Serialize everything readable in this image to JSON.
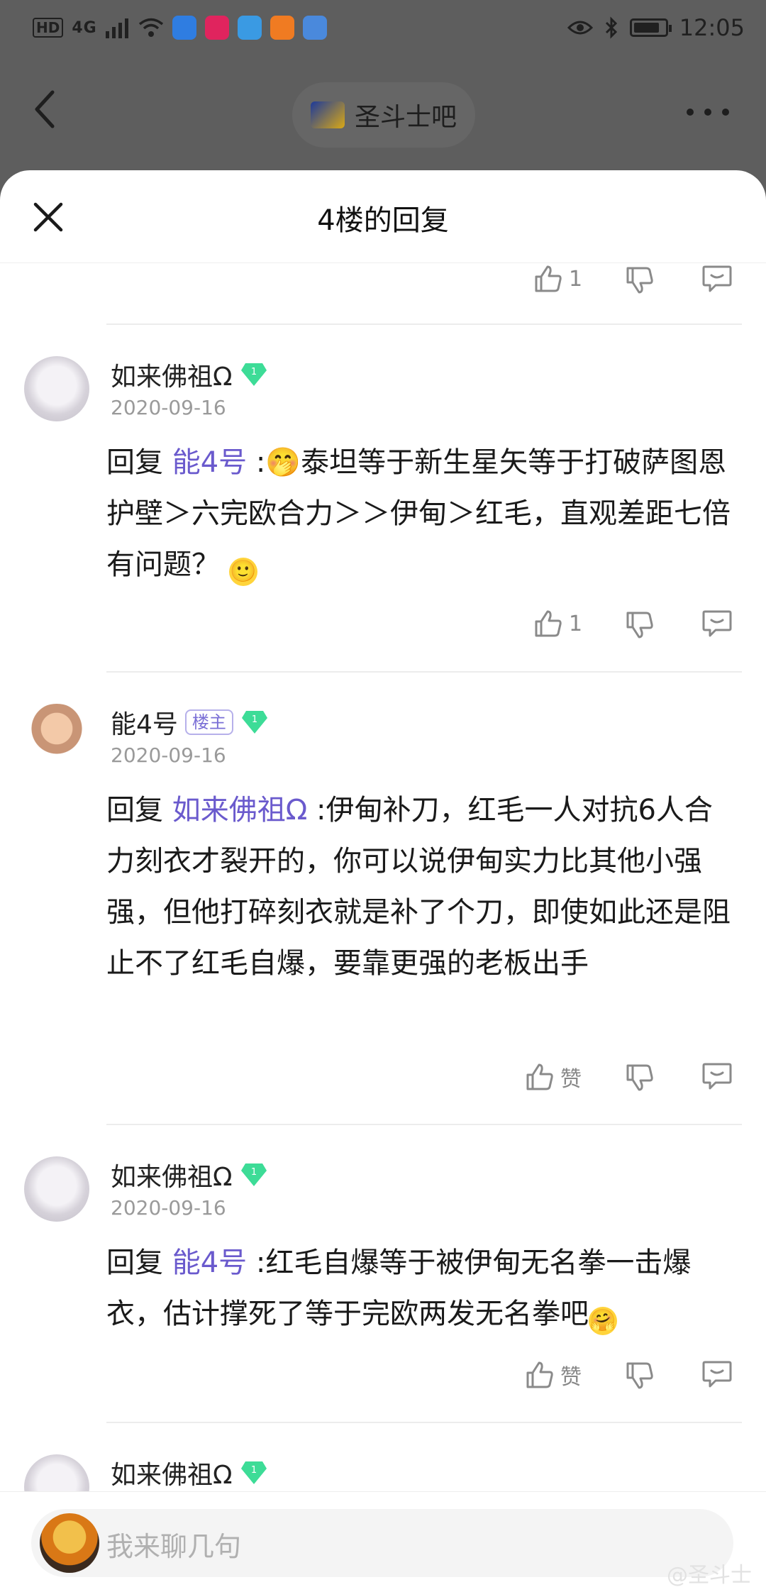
{
  "status_bar": {
    "hd": "HD",
    "network": "4G",
    "time": "12:05",
    "battery_level": 0.85
  },
  "nav": {
    "forum_name": "圣斗士吧"
  },
  "sheet": {
    "title": "4楼的回复"
  },
  "top_actions": {
    "like_count": "1"
  },
  "comments": [
    {
      "user": "如来佛祖Ω",
      "level": "1",
      "date": "2020-09-16",
      "reply_prefix": "回复 ",
      "mention": "能4号",
      "text": " :🤭泰坦等于新生星矢等于打破萨图恩护壁＞六完欧合力＞＞伊甸＞红毛，直观差距七倍有问题？",
      "emoji": "🙂",
      "like_label": "1"
    },
    {
      "user": "能4号",
      "owner_badge": "楼主",
      "level": "1",
      "date": "2020-09-16",
      "reply_prefix": "回复 ",
      "mention": "如来佛祖Ω",
      "text": " :伊甸补刀，红毛一人对抗6人合力刻衣才裂开的，你可以说伊甸实力比其他小强强，但他打碎刻衣就是补了个刀，即使如此还是阻止不了红毛自爆，要靠更强的老板出手",
      "like_label": "赞"
    },
    {
      "user": "如来佛祖Ω",
      "level": "1",
      "date": "2020-09-16",
      "reply_prefix": "回复 ",
      "mention": "能4号",
      "text": " :红毛自爆等于被伊甸无名拳一击爆衣，估计撑死了等于完欧两发无名拳吧",
      "emoji": "🤗",
      "like_label": "赞"
    },
    {
      "user": "如来佛祖Ω",
      "level": "1"
    }
  ],
  "input": {
    "placeholder": "我来聊几句"
  },
  "watermark": "@圣斗士",
  "colors": {
    "mention": "#6a5acd",
    "overlay": "#5e5e5e",
    "gem": "#3ddc97"
  }
}
